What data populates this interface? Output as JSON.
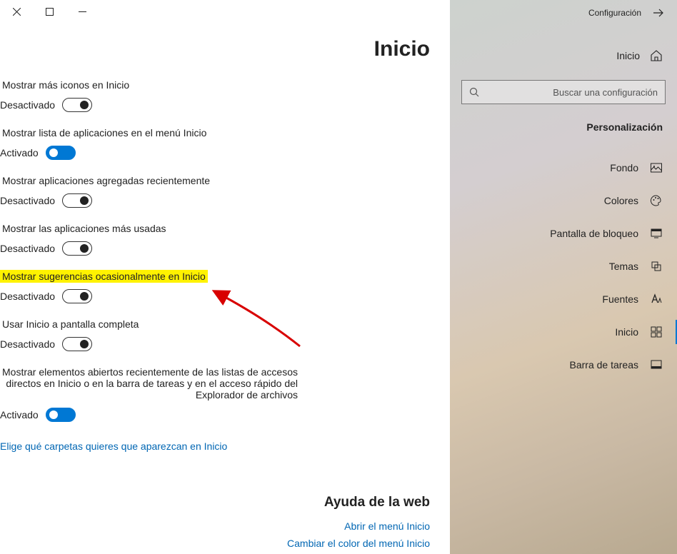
{
  "titlebar": {
    "app_name": "Configuración"
  },
  "sidebar": {
    "home_label": "Inicio",
    "search_placeholder": "Buscar una configuración",
    "section": "Personalización",
    "items": [
      {
        "label": "Fondo"
      },
      {
        "label": "Colores"
      },
      {
        "label": "Pantalla de bloqueo"
      },
      {
        "label": "Temas"
      },
      {
        "label": "Fuentes"
      },
      {
        "label": "Inicio"
      },
      {
        "label": "Barra de tareas"
      }
    ]
  },
  "page": {
    "title": "Inicio"
  },
  "toggle_states": {
    "on": "Activado",
    "off": "Desactivado"
  },
  "settings": [
    {
      "label": "Mostrar más iconos en Inicio",
      "on": false
    },
    {
      "label": "Mostrar lista de aplicaciones en el menú Inicio",
      "on": true
    },
    {
      "label": "Mostrar aplicaciones agregadas recientemente",
      "on": false
    },
    {
      "label": "Mostrar las aplicaciones más usadas",
      "on": false
    },
    {
      "label": "Mostrar sugerencias ocasionalmente en Inicio",
      "on": false,
      "highlighted": true
    },
    {
      "label": "Usar Inicio a pantalla completa",
      "on": false
    },
    {
      "label": "Mostrar elementos abiertos recientemente de las listas de accesos directos en Inicio o en la barra de tareas y en el acceso rápido del Explorador de archivos",
      "on": true
    }
  ],
  "choose_link": "Elige qué carpetas quieres que aparezcan en Inicio",
  "help": {
    "title": "Ayuda de la web",
    "links": [
      "Abrir el menú Inicio",
      "Cambiar el color del menú Inicio"
    ]
  }
}
